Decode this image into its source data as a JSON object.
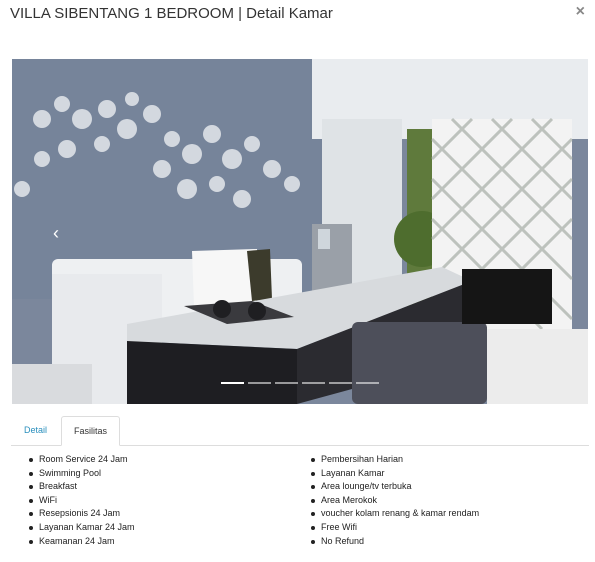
{
  "modal": {
    "title": "VILLA SIBENTANG 1 BEDROOM | Detail Kamar",
    "close_label": "×"
  },
  "carousel": {
    "prev_label": "‹",
    "slide_count": 6,
    "active_index": 0
  },
  "tabs": [
    {
      "label": "Detail",
      "active": false
    },
    {
      "label": "Fasilitas",
      "active": true
    }
  ],
  "facilities_left": [
    "Room Service 24 Jam",
    "Swimming Pool",
    "Breakfast",
    "WiFi",
    "Resepsionis 24 Jam",
    "Layanan Kamar 24 Jam",
    "Keamanan 24 Jam"
  ],
  "facilities_right": [
    "Pembersihan Harian",
    "Layanan Kamar",
    "Area lounge/tv terbuka",
    "Area Merokok",
    "voucher kolam renang & kamar rendam",
    "Free Wifi",
    "No Refund"
  ],
  "colors": {
    "link_blue": "#2a8fbd",
    "wall_blue": "#7d8aa0"
  }
}
